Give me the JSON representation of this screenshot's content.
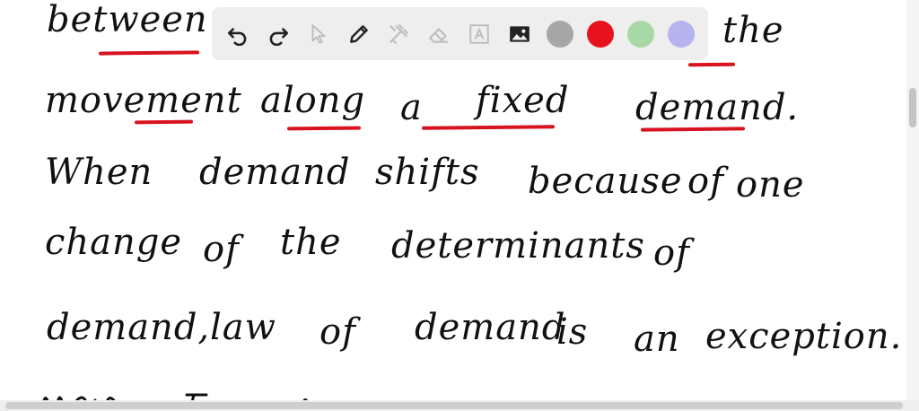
{
  "notes": {
    "lines": [
      [
        "between",
        "the"
      ],
      [
        "movement",
        "along",
        "a",
        "fixed",
        "demand."
      ],
      [
        "When",
        "demand",
        "shifts",
        "because",
        "of",
        "one"
      ],
      [
        "change",
        "of",
        "the",
        "determinants",
        "of"
      ],
      [
        "demand,",
        "law",
        "of",
        "demand",
        "is",
        "an",
        "exception."
      ]
    ]
  },
  "toolbar": {
    "tools": [
      "undo-icon",
      "redo-icon",
      "pointer-icon",
      "pen-icon",
      "tools-icon",
      "eraser-icon",
      "text-icon",
      "image-icon"
    ],
    "colors": [
      "#a6a6a6",
      "#e8121f",
      "#a9d8a7",
      "#b6b3ef"
    ]
  }
}
